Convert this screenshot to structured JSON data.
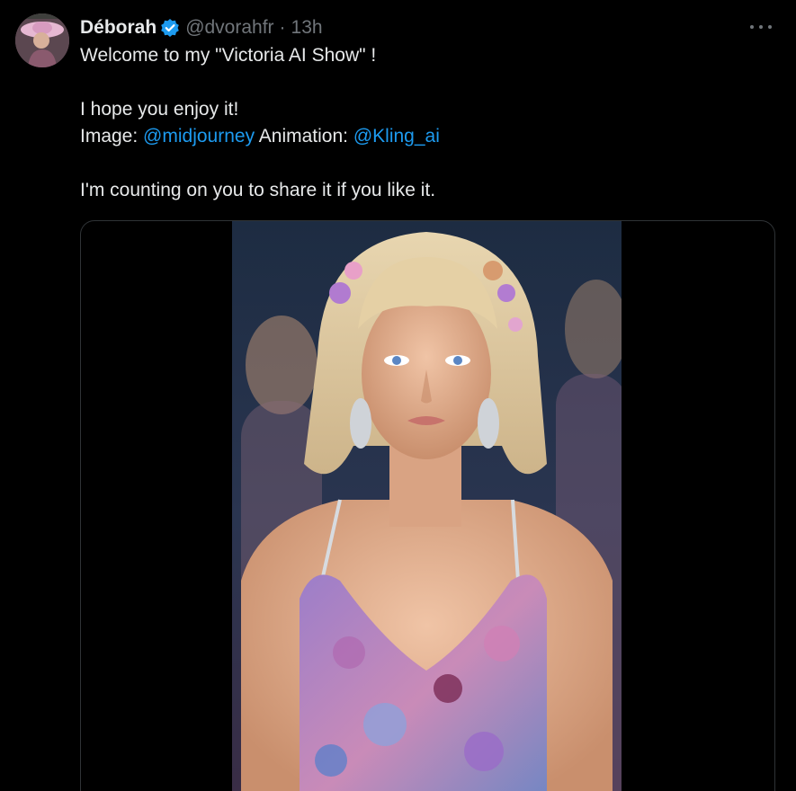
{
  "author": {
    "display_name": "Déborah",
    "handle": "@dvorahfr",
    "separator": "·",
    "time": "13h"
  },
  "tweet": {
    "line1": "Welcome to my \"Victoria AI Show\" !",
    "line2": "I hope you enjoy it!",
    "image_label": "Image: ",
    "image_mention": "@midjourney",
    "animation_label": "Animation: ",
    "animation_mention": "@Kling_ai",
    "line4": "I'm counting on you to share it if you like it."
  },
  "colors": {
    "background": "#000000",
    "text": "#e7e9ea",
    "secondary": "#71767b",
    "link": "#1d9bf0",
    "verified": "#1d9bf0"
  },
  "icons": {
    "verified": "verified-badge-icon",
    "more": "more-options-icon"
  }
}
